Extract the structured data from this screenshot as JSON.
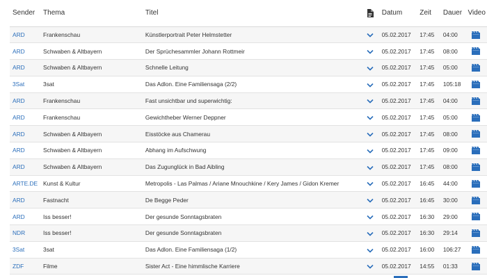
{
  "header": {
    "sender": "Sender",
    "thema": "Thema",
    "titel": "Titel",
    "doc_icon": "document-icon",
    "datum": "Datum",
    "zeit": "Zeit",
    "dauer": "Dauer",
    "video": "Video"
  },
  "rows": [
    {
      "sender": "ARD",
      "thema": "Frankenschau",
      "titel": "Künstlerportrait Peter Helmstetter",
      "datum": "05.02.2017",
      "zeit": "17:45",
      "dauer": "04:00"
    },
    {
      "sender": "ARD",
      "thema": "Schwaben & Altbayern",
      "titel": "Der Sprüchesammler Johann Rottmeir",
      "datum": "05.02.2017",
      "zeit": "17:45",
      "dauer": "08:00"
    },
    {
      "sender": "ARD",
      "thema": "Schwaben & Altbayern",
      "titel": "Schnelle Leitung",
      "datum": "05.02.2017",
      "zeit": "17:45",
      "dauer": "05:00"
    },
    {
      "sender": "3Sat",
      "thema": "3sat",
      "titel": "Das Adlon. Eine Familiensaga (2/2)",
      "datum": "05.02.2017",
      "zeit": "17:45",
      "dauer": "105:18"
    },
    {
      "sender": "ARD",
      "thema": "Frankenschau",
      "titel": "Fast unsichtbar und superwichtig:",
      "datum": "05.02.2017",
      "zeit": "17:45",
      "dauer": "04:00"
    },
    {
      "sender": "ARD",
      "thema": "Frankenschau",
      "titel": "Gewichtheber Werner Deppner",
      "datum": "05.02.2017",
      "zeit": "17:45",
      "dauer": "05:00"
    },
    {
      "sender": "ARD",
      "thema": "Schwaben & Altbayern",
      "titel": "Eisstöcke aus Chamerau",
      "datum": "05.02.2017",
      "zeit": "17:45",
      "dauer": "08:00"
    },
    {
      "sender": "ARD",
      "thema": "Schwaben & Altbayern",
      "titel": "Abhang im Aufschwung",
      "datum": "05.02.2017",
      "zeit": "17:45",
      "dauer": "09:00"
    },
    {
      "sender": "ARD",
      "thema": "Schwaben & Altbayern",
      "titel": "Das Zugunglück in Bad Aibling",
      "datum": "05.02.2017",
      "zeit": "17:45",
      "dauer": "08:00"
    },
    {
      "sender": "ARTE.DE",
      "thema": "Kunst & Kultur",
      "titel": "Metropolis - Las Palmas / Ariane Mnouchkine / Kery James / Gidon Kremer",
      "datum": "05.02.2017",
      "zeit": "16:45",
      "dauer": "44:00"
    },
    {
      "sender": "ARD",
      "thema": "Fastnacht",
      "titel": "De Begge Peder",
      "datum": "05.02.2017",
      "zeit": "16:45",
      "dauer": "30:00"
    },
    {
      "sender": "ARD",
      "thema": "Iss besser!",
      "titel": "Der gesunde Sonntagsbraten",
      "datum": "05.02.2017",
      "zeit": "16:30",
      "dauer": "29:00"
    },
    {
      "sender": "NDR",
      "thema": "Iss besser!",
      "titel": "Der gesunde Sonntagsbraten",
      "datum": "05.02.2017",
      "zeit": "16:30",
      "dauer": "29:14"
    },
    {
      "sender": "3Sat",
      "thema": "3sat",
      "titel": "Das Adlon. Eine Familiensaga (1/2)",
      "datum": "05.02.2017",
      "zeit": "16:00",
      "dauer": "106:27"
    },
    {
      "sender": "ZDF",
      "thema": "Filme",
      "titel": "Sister Act - Eine himmlische Karriere",
      "datum": "05.02.2017",
      "zeit": "14:55",
      "dauer": "01:33"
    }
  ],
  "icons": {
    "expand": "chevron-down-icon",
    "video": "film-icon"
  },
  "colors": {
    "link": "#2a6ebb",
    "icon": "#2a6ebb",
    "stripe": "#f6f6f6"
  }
}
